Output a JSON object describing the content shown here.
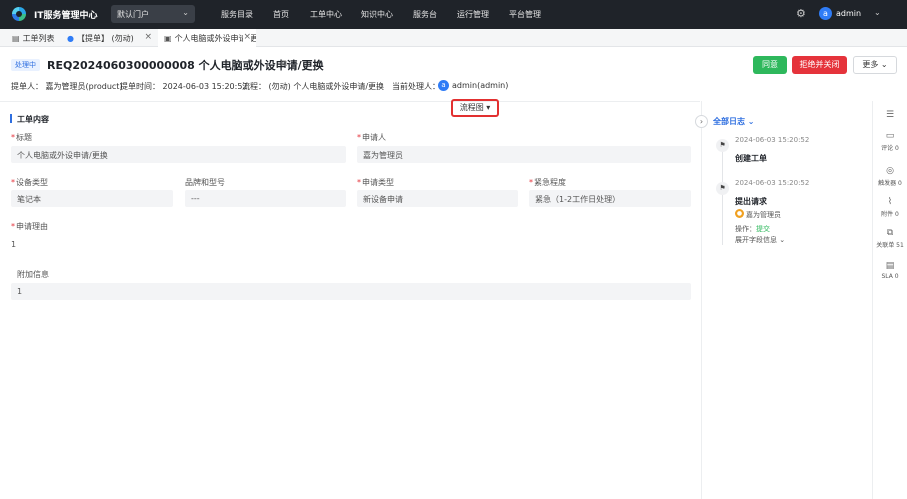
{
  "app": {
    "title": "IT服务管理中心",
    "portal": "默认门户",
    "user_initial": "a",
    "username": "admin"
  },
  "nav": {
    "items": [
      "服务目录",
      "首页",
      "工单中心",
      "知识中心",
      "服务台",
      "运行管理",
      "平台管理"
    ]
  },
  "tabs": [
    {
      "label": "工单列表"
    },
    {
      "label": "【提单】 (勿动)"
    },
    {
      "label": "个人电脑或外设申请/更换"
    }
  ],
  "ticket": {
    "status": "处理中",
    "id_title": "REQ2024060300000008  个人电脑或外设申请/更换",
    "meta_submitter": "提单人：  嘉为管理员(product)",
    "meta_time": "提单时间：  2024-06-03 15:20:52",
    "meta_flow": "流程：  (勿动) 个人电脑或外设申请/更换",
    "meta_handler_label": "当前处理人：",
    "handler_initial": "a",
    "handler": "admin(admin)"
  },
  "actions": {
    "approve": "同意",
    "reject": "拒绝并关闭",
    "more": "更多"
  },
  "flow_toggle": "流程图",
  "form": {
    "section_title": "工单内容",
    "title_label": "标题",
    "title_value": "个人电脑或外设申请/更换",
    "applicant_label": "申请人",
    "applicant_value": "嘉为管理员",
    "device_type_label": "设备类型",
    "device_type_value": "笔记本",
    "brand_label": "品牌和型号",
    "brand_value": "---",
    "apply_type_label": "申请类型",
    "apply_type_value": "新设备申请",
    "urgency_label": "紧急程度",
    "urgency_value": "紧急（1-2工作日处理）",
    "reason_label": "申请理由",
    "reason_value": "1",
    "extra_label": "附加信息",
    "extra_value": "1"
  },
  "log": {
    "header": "全部日志",
    "entries": [
      {
        "time": "2024-06-03 15:20:52",
        "title": "创建工单"
      },
      {
        "time": "2024-06-03 15:20:52",
        "title": "提出请求",
        "user": "嘉为管理员",
        "action_label": "操作：",
        "action": "提交",
        "expand": "展开字段信息"
      }
    ]
  },
  "rail": [
    {
      "label": "评论 0"
    },
    {
      "label": "触发器 0"
    },
    {
      "label": "附件 0"
    },
    {
      "label": "关联单 51"
    },
    {
      "label": "SLA 0"
    }
  ],
  "colors": {
    "nav_bg": "#1f2329",
    "accent": "#2f6fe0",
    "approve": "#2eb85c",
    "reject": "#e5333b",
    "highlight": "#e23030"
  }
}
